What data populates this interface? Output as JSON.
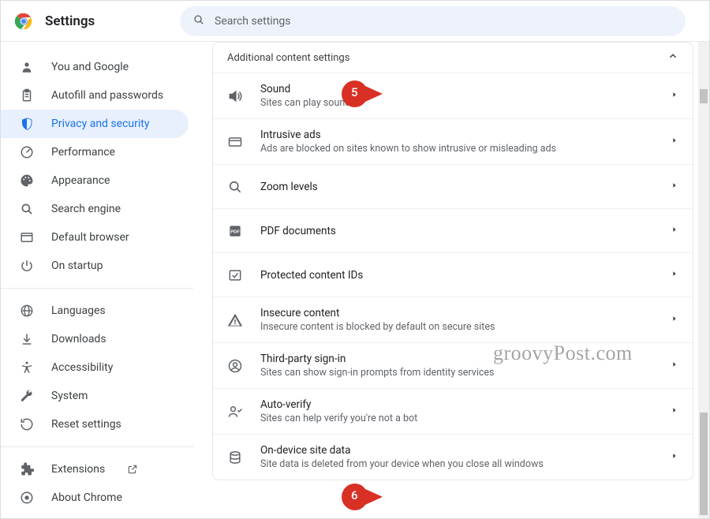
{
  "header": {
    "title": "Settings",
    "search_placeholder": "Search settings"
  },
  "sidebar": {
    "items": [
      {
        "icon": "person",
        "label": "You and Google"
      },
      {
        "icon": "clipboard",
        "label": "Autofill and passwords"
      },
      {
        "icon": "shield",
        "label": "Privacy and security",
        "active": true
      },
      {
        "icon": "gauge",
        "label": "Performance"
      },
      {
        "icon": "palette",
        "label": "Appearance"
      },
      {
        "icon": "search",
        "label": "Search engine"
      },
      {
        "icon": "browser",
        "label": "Default browser"
      },
      {
        "icon": "power",
        "label": "On startup"
      }
    ],
    "items2": [
      {
        "icon": "globe",
        "label": "Languages"
      },
      {
        "icon": "download",
        "label": "Downloads"
      },
      {
        "icon": "accessibility",
        "label": "Accessibility"
      },
      {
        "icon": "wrench",
        "label": "System"
      },
      {
        "icon": "restore",
        "label": "Reset settings"
      }
    ],
    "items3": [
      {
        "icon": "extension",
        "label": "Extensions",
        "launch": true
      },
      {
        "icon": "aboutchrome",
        "label": "About Chrome"
      }
    ]
  },
  "card": {
    "header": "Additional content settings",
    "rows": [
      {
        "icon": "sound",
        "title": "Sound",
        "subtitle": "Sites can play sound"
      },
      {
        "icon": "ads",
        "title": "Intrusive ads",
        "subtitle": "Ads are blocked on sites known to show intrusive or misleading ads"
      },
      {
        "icon": "zoom",
        "title": "Zoom levels",
        "subtitle": ""
      },
      {
        "icon": "pdf",
        "title": "PDF documents",
        "subtitle": ""
      },
      {
        "icon": "protected",
        "title": "Protected content IDs",
        "subtitle": ""
      },
      {
        "icon": "warning",
        "title": "Insecure content",
        "subtitle": "Insecure content is blocked by default on secure sites"
      },
      {
        "icon": "identity",
        "title": "Third-party sign-in",
        "subtitle": "Sites can show sign-in prompts from identity services"
      },
      {
        "icon": "autoverify",
        "title": "Auto-verify",
        "subtitle": "Sites can help verify you're not a bot"
      },
      {
        "icon": "storage",
        "title": "On-device site data",
        "subtitle": "Site data is deleted from your device when you close all windows"
      }
    ]
  },
  "callouts": {
    "a": "5",
    "b": "6"
  },
  "watermark": "groovyPost.com"
}
